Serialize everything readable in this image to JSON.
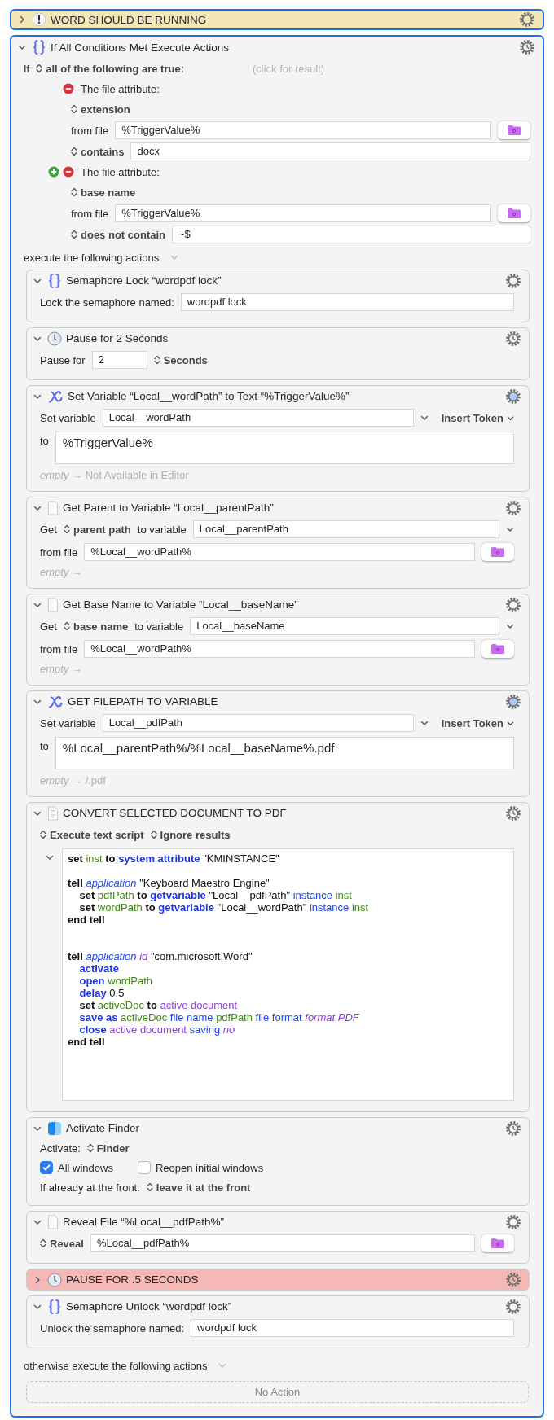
{
  "actions": [
    {
      "kind": "group",
      "title": "WORD SHOULD BE RUNNING",
      "expanded": false,
      "selected": true,
      "color": "#f3e6b8",
      "timer": false,
      "highlighted": false
    },
    {
      "kind": "if",
      "title": "If All Conditions Met Execute Actions",
      "expanded": true,
      "selected": true,
      "timer": true,
      "highlighted": false,
      "rows": [
        [
          {
            "kind": "text",
            "text": "If"
          },
          {
            "kind": "popup",
            "text": "all of the following are true:"
          },
          {
            "kind": "hint",
            "text": "(click for result)"
          }
        ]
      ],
      "conditions": [
        {
          "add": false,
          "label": "The file attribute:",
          "rows": [
            [
              {
                "kind": "popup",
                "text": "extension"
              }
            ],
            [
              {
                "kind": "text",
                "text": "from file"
              },
              {
                "kind": "field",
                "text": "%TriggerValue%"
              },
              {
                "kind": "folder"
              }
            ],
            [
              {
                "kind": "popup",
                "text": "contains"
              },
              {
                "kind": "field",
                "text": "docx"
              }
            ]
          ]
        },
        {
          "add": true,
          "label": "The file attribute:",
          "rows": [
            [
              {
                "kind": "popup",
                "text": "base name"
              }
            ],
            [
              {
                "kind": "text",
                "text": "from file"
              },
              {
                "kind": "field",
                "text": "%TriggerValue%"
              },
              {
                "kind": "folder"
              }
            ],
            [
              {
                "kind": "popup",
                "text": "does not contain"
              },
              {
                "kind": "field",
                "text": "~$"
              }
            ]
          ]
        }
      ],
      "then_label": "execute the following actions",
      "actions": [
        {
          "kind": "semaphore",
          "title": "Semaphore Lock “wordpdf lock”",
          "expanded": true,
          "selected": false,
          "timer": false,
          "highlighted": false,
          "rows": [
            [
              {
                "kind": "text",
                "text": "Lock the semaphore named:"
              },
              {
                "kind": "field",
                "text": "wordpdf lock"
              }
            ]
          ]
        },
        {
          "kind": "pause",
          "title": "Pause for 2 Seconds",
          "expanded": true,
          "selected": false,
          "timer": true,
          "highlighted": false,
          "rows": [
            [
              {
                "kind": "text",
                "text": "Pause for"
              },
              {
                "kind": "short",
                "text": "2"
              },
              {
                "kind": "popup",
                "text": "Seconds"
              }
            ]
          ]
        },
        {
          "kind": "variable",
          "title": "Set Variable “Local__wordPath” to Text “%TriggerValue%”",
          "expanded": true,
          "selected": false,
          "timer": false,
          "highlighted": true,
          "rows": [
            [
              {
                "kind": "text",
                "text": "Set variable"
              },
              {
                "kind": "field",
                "text": "Local__wordPath"
              },
              {
                "kind": "menu"
              },
              {
                "kind": "token",
                "text": "Insert Token"
              }
            ],
            [
              {
                "kind": "text",
                "text": "to"
              },
              {
                "kind": "area",
                "text": "%TriggerValue%"
              }
            ],
            [
              {
                "kind": "result",
                "text": "*empty* → Not Available in Editor"
              }
            ]
          ]
        },
        {
          "kind": "file",
          "title": "Get Parent to Variable “Local__parentPath”",
          "expanded": true,
          "selected": false,
          "timer": false,
          "highlighted": false,
          "rows": [
            [
              {
                "kind": "text",
                "text": "Get"
              },
              {
                "kind": "popup",
                "text": "parent path"
              },
              {
                "kind": "text",
                "text": "to variable"
              },
              {
                "kind": "field",
                "text": "Local__parentPath"
              },
              {
                "kind": "menu"
              }
            ],
            [
              {
                "kind": "text",
                "text": "from file"
              },
              {
                "kind": "field",
                "text": "%Local__wordPath%"
              },
              {
                "kind": "folder"
              }
            ],
            [
              {
                "kind": "result",
                "text": "*empty* →"
              }
            ]
          ]
        },
        {
          "kind": "file",
          "title": "Get Base Name to Variable “Local__baseName”",
          "expanded": true,
          "selected": false,
          "timer": false,
          "highlighted": false,
          "rows": [
            [
              {
                "kind": "text",
                "text": "Get"
              },
              {
                "kind": "popup",
                "text": "base name"
              },
              {
                "kind": "text",
                "text": "to variable"
              },
              {
                "kind": "field",
                "text": "Local__baseName"
              },
              {
                "kind": "menu"
              }
            ],
            [
              {
                "kind": "text",
                "text": "from file"
              },
              {
                "kind": "field",
                "text": "%Local__wordPath%"
              },
              {
                "kind": "folder"
              }
            ],
            [
              {
                "kind": "result",
                "text": "*empty* →"
              }
            ]
          ]
        },
        {
          "kind": "variable",
          "title": "GET FILEPATH TO VARIABLE",
          "expanded": true,
          "selected": false,
          "timer": false,
          "highlighted": true,
          "rows": [
            [
              {
                "kind": "text",
                "text": "Set variable"
              },
              {
                "kind": "field",
                "text": "Local__pdfPath"
              },
              {
                "kind": "menu"
              },
              {
                "kind": "token",
                "text": "Insert Token"
              }
            ],
            [
              {
                "kind": "text",
                "text": "to"
              },
              {
                "kind": "area",
                "text": "%Local__parentPath%/%Local__baseName%.pdf"
              }
            ],
            [
              {
                "kind": "result",
                "text": "*empty* → /.pdf"
              }
            ]
          ]
        },
        {
          "kind": "script",
          "title": "CONVERT SELECTED DOCUMENT TO PDF",
          "expanded": true,
          "selected": false,
          "timer": true,
          "highlighted": false,
          "rows": [
            [
              {
                "kind": "popup",
                "text": "Execute text script"
              },
              {
                "kind": "popup",
                "text": "Ignore results"
              }
            ],
            [
              {
                "kind": "code",
                "expanded": true,
                "lines": [
                  {
                    "kind": "line",
                    "tokens": [
                      {
                        "t": "set",
                        "kind": "keyword"
                      },
                      {
                        "t": " inst",
                        "kind": "variable"
                      },
                      {
                        "t": " to",
                        "kind": "keyword"
                      },
                      {
                        "t": " system attribute",
                        "kind": "command"
                      },
                      {
                        "t": " \"KMINSTANCE\"",
                        "kind": "string"
                      }
                    ]
                  },
                  {
                    "kind": "gap",
                    "tokens": [
                      {
                        "t": "tell",
                        "kind": "keyword"
                      },
                      {
                        "t": " application",
                        "kind": "class"
                      },
                      {
                        "t": " \"Keyboard Maestro Engine\"",
                        "kind": "string"
                      }
                    ]
                  },
                  {
                    "kind": "line",
                    "tokens": [
                      {
                        "t": "\tset",
                        "kind": "keyword"
                      },
                      {
                        "t": " pdfPath",
                        "kind": "variable"
                      },
                      {
                        "t": " to",
                        "kind": "keyword"
                      },
                      {
                        "t": " getvariable",
                        "kind": "command"
                      },
                      {
                        "t": " \"Local__pdfPath\"",
                        "kind": "string"
                      },
                      {
                        "t": " instance",
                        "kind": "parameter"
                      },
                      {
                        "t": " inst",
                        "kind": "variable"
                      }
                    ]
                  },
                  {
                    "kind": "line",
                    "tokens": [
                      {
                        "t": "\tset",
                        "kind": "keyword"
                      },
                      {
                        "t": " wordPath",
                        "kind": "variable"
                      },
                      {
                        "t": " to",
                        "kind": "keyword"
                      },
                      {
                        "t": " getvariable",
                        "kind": "command"
                      },
                      {
                        "t": " \"Local__wordPath\"",
                        "kind": "string"
                      },
                      {
                        "t": " instance",
                        "kind": "parameter"
                      },
                      {
                        "t": " inst",
                        "kind": "variable"
                      }
                    ]
                  },
                  {
                    "kind": "line",
                    "tokens": [
                      {
                        "t": "end tell",
                        "kind": "keyword"
                      }
                    ]
                  },
                  {
                    "kind": "wide_gap",
                    "tokens": [
                      {
                        "t": "tell",
                        "kind": "keyword"
                      },
                      {
                        "t": " application",
                        "kind": "class"
                      },
                      {
                        "t": " id",
                        "kind": "constant"
                      },
                      {
                        "t": " \"com.microsoft.Word\"",
                        "kind": "string"
                      }
                    ]
                  },
                  {
                    "kind": "line",
                    "tokens": [
                      {
                        "t": "\tactivate",
                        "kind": "command"
                      }
                    ]
                  },
                  {
                    "kind": "line",
                    "tokens": [
                      {
                        "t": "\topen",
                        "kind": "command"
                      },
                      {
                        "t": " wordPath",
                        "kind": "variable"
                      }
                    ]
                  },
                  {
                    "kind": "line",
                    "tokens": [
                      {
                        "t": "\tdelay",
                        "kind": "command"
                      },
                      {
                        "t": " 0.5",
                        "kind": "string"
                      }
                    ]
                  },
                  {
                    "kind": "line",
                    "tokens": [
                      {
                        "t": "\tset",
                        "kind": "keyword"
                      },
                      {
                        "t": " activeDoc",
                        "kind": "variable"
                      },
                      {
                        "t": " to",
                        "kind": "keyword"
                      },
                      {
                        "t": " active document",
                        "kind": "property"
                      }
                    ]
                  },
                  {
                    "kind": "line",
                    "tokens": [
                      {
                        "t": "\tsave as",
                        "kind": "command"
                      },
                      {
                        "t": " activeDoc",
                        "kind": "variable"
                      },
                      {
                        "t": " file name",
                        "kind": "parameter"
                      },
                      {
                        "t": " pdfPath",
                        "kind": "variable"
                      },
                      {
                        "t": " file format",
                        "kind": "parameter"
                      },
                      {
                        "t": " format PDF",
                        "kind": "constant"
                      }
                    ]
                  },
                  {
                    "kind": "line",
                    "tokens": [
                      {
                        "t": "\tclose",
                        "kind": "command"
                      },
                      {
                        "t": " active document",
                        "kind": "property"
                      },
                      {
                        "t": " saving",
                        "kind": "parameter"
                      },
                      {
                        "t": " no",
                        "kind": "constant"
                      }
                    ]
                  },
                  {
                    "kind": "line",
                    "tokens": [
                      {
                        "t": "end tell",
                        "kind": "keyword"
                      }
                    ]
                  }
                ]
              }
            ]
          ]
        },
        {
          "kind": "activate",
          "title": "Activate Finder",
          "expanded": true,
          "selected": false,
          "timer": true,
          "highlighted": false,
          "rows": [
            [
              {
                "kind": "text",
                "text": "Activate:"
              },
              {
                "kind": "popup",
                "text": "Finder"
              }
            ],
            [
              {
                "kind": "checkbox",
                "text": "All windows",
                "checked": true
              },
              {
                "kind": "checkbox",
                "text": "Reopen initial windows",
                "checked": false
              }
            ],
            [
              {
                "kind": "text",
                "text": "If already at the front:"
              },
              {
                "kind": "popup",
                "text": "leave it at the front"
              }
            ]
          ]
        },
        {
          "kind": "file",
          "title": "Reveal File “%Local__pdfPath%”",
          "expanded": true,
          "selected": false,
          "timer": false,
          "highlighted": false,
          "rows": [
            [
              {
                "kind": "popup",
                "text": "Reveal"
              },
              {
                "kind": "field",
                "text": "%Local__pdfPath%"
              },
              {
                "kind": "folder"
              }
            ]
          ]
        },
        {
          "kind": "pause",
          "title": "PAUSE FOR .5 SECONDS",
          "expanded": false,
          "selected": false,
          "color": "#f5b8b6",
          "timer": true,
          "highlighted": false
        },
        {
          "kind": "semaphore",
          "title": "Semaphore Unlock “wordpdf lock”",
          "expanded": true,
          "selected": false,
          "timer": false,
          "highlighted": false,
          "rows": [
            [
              {
                "kind": "text",
                "text": "Unlock the semaphore named:"
              },
              {
                "kind": "field",
                "text": "wordpdf lock"
              }
            ]
          ]
        }
      ],
      "else_label": "otherwise execute the following actions",
      "else_placeholder": "No Action"
    }
  ]
}
